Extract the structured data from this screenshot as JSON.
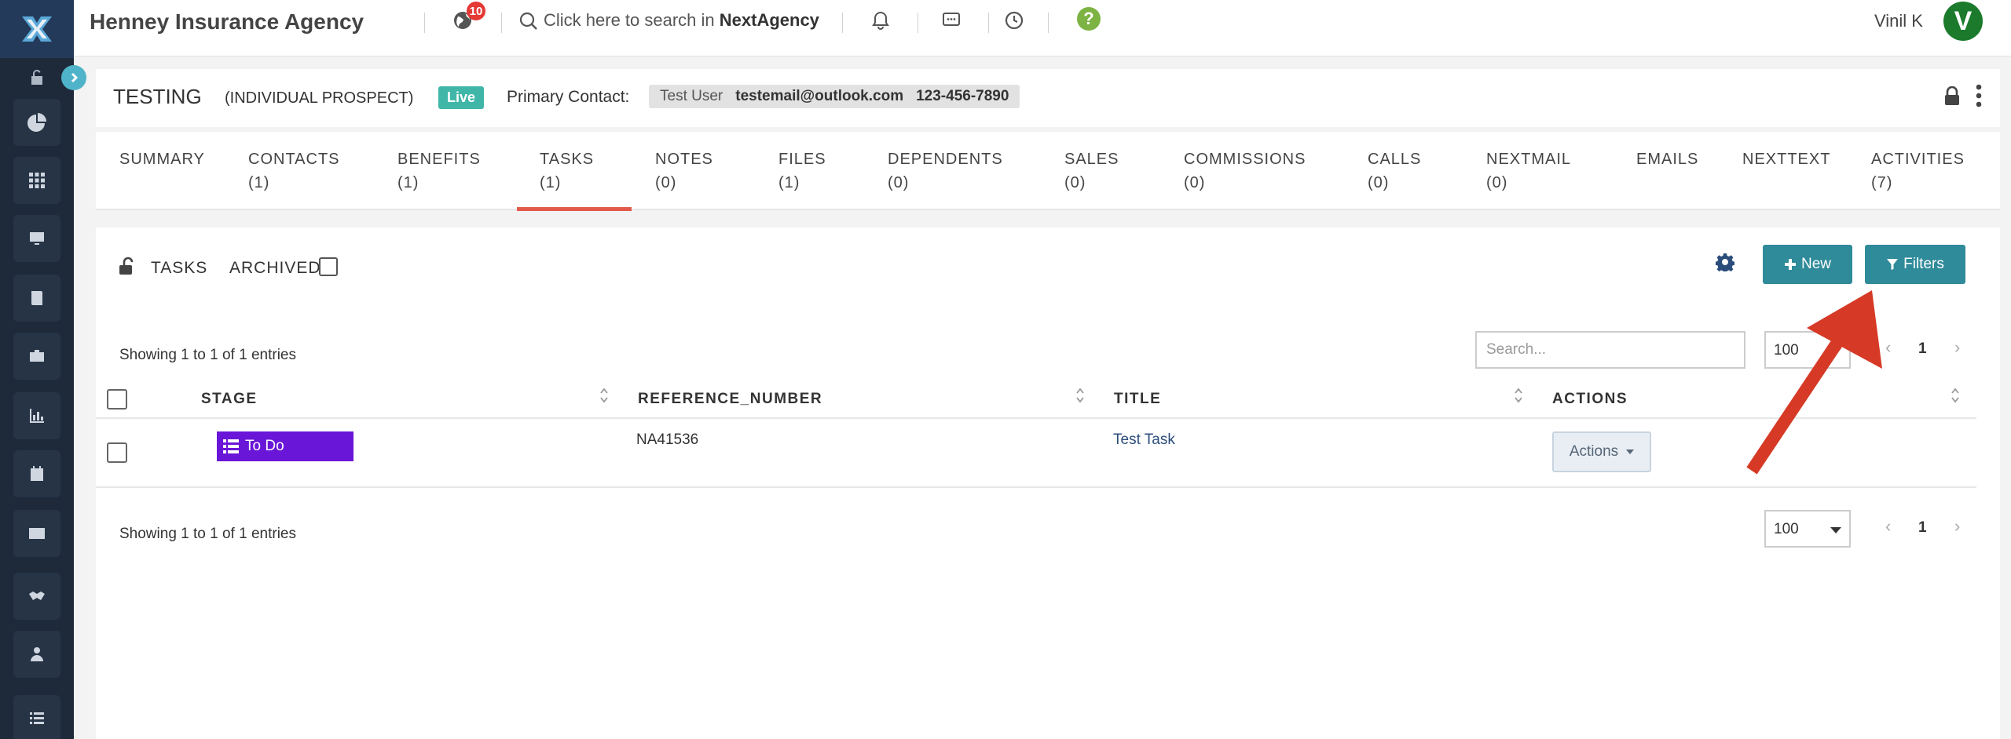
{
  "topbar": {
    "agency_name": "Henney Insurance Agency",
    "notification_count": "10",
    "search_prefix": "Click here to search in ",
    "search_brand": "NextAgency",
    "help_label": "?",
    "user_name": "Vinil K",
    "avatar_initial": "V"
  },
  "record": {
    "name": "TESTING",
    "type": "(INDIVIDUAL PROSPECT)",
    "status_badge": "Live",
    "primary_contact_label": "Primary Contact:",
    "contact_name": "Test User",
    "contact_email": "testemail@outlook.com",
    "contact_phone": "123-456-7890"
  },
  "tabs": [
    {
      "label": "SUMMARY",
      "count": ""
    },
    {
      "label": "CONTACTS",
      "count": "(1)"
    },
    {
      "label": "BENEFITS",
      "count": "(1)"
    },
    {
      "label": "TASKS",
      "count": "(1)"
    },
    {
      "label": "NOTES",
      "count": "(0)"
    },
    {
      "label": "FILES",
      "count": "(1)"
    },
    {
      "label": "DEPENDENTS",
      "count": "(0)"
    },
    {
      "label": "SALES",
      "count": "(0)"
    },
    {
      "label": "COMMISSIONS",
      "count": "(0)"
    },
    {
      "label": "CALLS",
      "count": "(0)"
    },
    {
      "label": "NEXTMAIL",
      "count": "(0)"
    },
    {
      "label": "EMAILS",
      "count": ""
    },
    {
      "label": "NEXTTEXT",
      "count": ""
    },
    {
      "label": "ACTIVITIES",
      "count": "(7)"
    }
  ],
  "active_tab": "TASKS",
  "panel": {
    "title": "TASKS",
    "archived_label": "ARCHIVED",
    "new_button": "New",
    "filters_button": "Filters",
    "info_top": "Showing 1 to 1 of 1 entries",
    "info_bottom": "Showing 1 to 1 of 1 entries",
    "search_placeholder": "Search...",
    "page_size": "100",
    "page_size_bottom": "100",
    "prev": "‹",
    "next": "›",
    "current_page": "1"
  },
  "table": {
    "columns": [
      "STAGE",
      "REFERENCE_NUMBER",
      "TITLE",
      "ACTIONS"
    ],
    "rows": [
      {
        "stage": "To Do",
        "reference_number": "NA41536",
        "title": "Test Task",
        "actions": "Actions"
      }
    ]
  },
  "colors": {
    "sidebar": "#1e2a3a",
    "accent_button": "#2f8a9a",
    "live_badge": "#3fb6a8",
    "stage_todo": "#6a16d8",
    "active_tab_underline": "#e15a4c",
    "annotation_arrow": "#d63a26"
  }
}
